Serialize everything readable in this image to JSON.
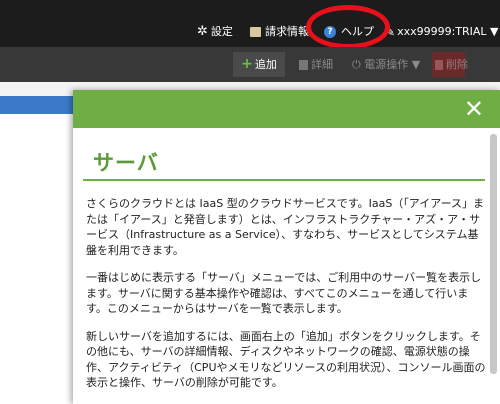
{
  "header": {
    "settings_label": "設定",
    "invoice_label": "請求情報",
    "help_label": "ヘルプ",
    "user_label": "xxx99999:TRIAL ▼",
    "highlight_color": "#e8101a"
  },
  "toolbar": {
    "add_label": "追加",
    "detail_label": "詳細",
    "power_label": "電源操作 ▼",
    "delete_label": "削除"
  },
  "modal": {
    "close_symbol": "✕",
    "title": "サーバ",
    "paragraphs": [
      "さくらのクラウドとは IaaS 型のクラウドサービスです。IaaS（「アイアース」または「イアース」と発音します）とは、インフラストラクチャー・アズ・ア・サービス（Infrastructure as a Service）、すなわち、サービスとしてシステム基盤を利用できます。",
      "一番はじめに表示する「サーバ」メニューでは、ご利用中のサーバー覧を表示します。サーバに関する基本操作や確認は、すべてこのメニューを通して行います。このメニューからはサーバを一覧で表示します。",
      "新しいサーバを追加するには、画面右上の「追加」ボタンをクリックします。その他にも、サーバの詳細情報、ディスクやネットワークの確認、電源状態の操作、アクティビティ（CPUやメモリなどリソースの利用状況）、コンソール画面の表示と操作、サーバの削除が可能です。"
    ]
  },
  "colors": {
    "accent_green": "#6fae44",
    "title_green": "#5b9a36",
    "topbar": "#1c1c1c",
    "toolbar": "#383838"
  }
}
